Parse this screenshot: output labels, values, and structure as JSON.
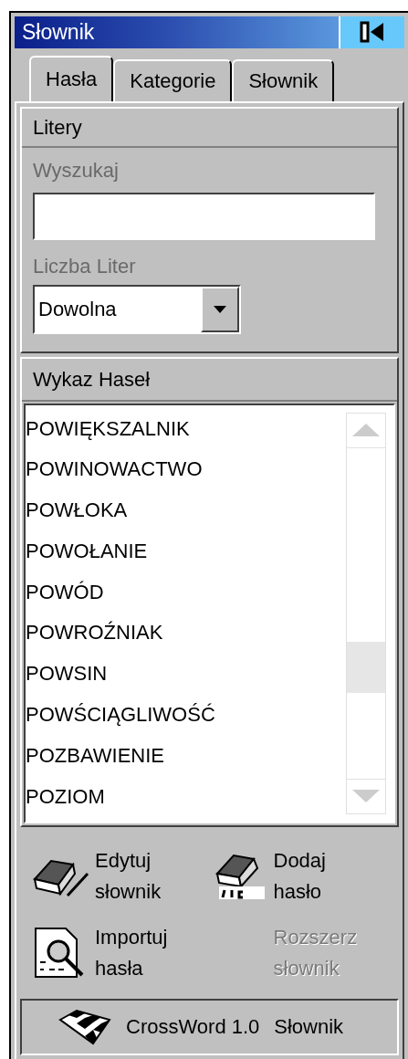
{
  "window": {
    "title": "Słownik"
  },
  "tabs": [
    {
      "label": "Hasła",
      "selected": true
    },
    {
      "label": "Kategorie",
      "selected": false
    },
    {
      "label": "Słownik",
      "selected": false
    }
  ],
  "letters_group": {
    "title": "Litery",
    "search_label": "Wyszukaj",
    "length_label": "Liczba Liter",
    "length_value": "Dowolna"
  },
  "entries": {
    "title": "Wykaz Haseł",
    "items": [
      "POWIĘKSZALNIK",
      "POWINOWACTWO",
      "POWŁOKA",
      "POWOŁANIE",
      "POWÓD",
      "POWROŹNIAK",
      "POWSIN",
      "POWŚCIĄGLIWOŚĆ",
      "POZBAWIENIE",
      "POZIOM"
    ]
  },
  "actions": [
    {
      "kind": "edit",
      "lines": [
        "Edytuj",
        "słownik"
      ],
      "disabled": false
    },
    {
      "kind": "add",
      "lines": [
        "Dodaj",
        "hasło"
      ],
      "disabled": false
    },
    {
      "kind": "import",
      "lines": [
        "Importuj",
        "hasła"
      ],
      "disabled": false
    },
    {
      "kind": "extend",
      "lines": [
        "Rozszerz",
        "słownik"
      ],
      "disabled": true
    }
  ],
  "footer": {
    "product": "CrossWord 1.0",
    "label": "Słownik"
  }
}
